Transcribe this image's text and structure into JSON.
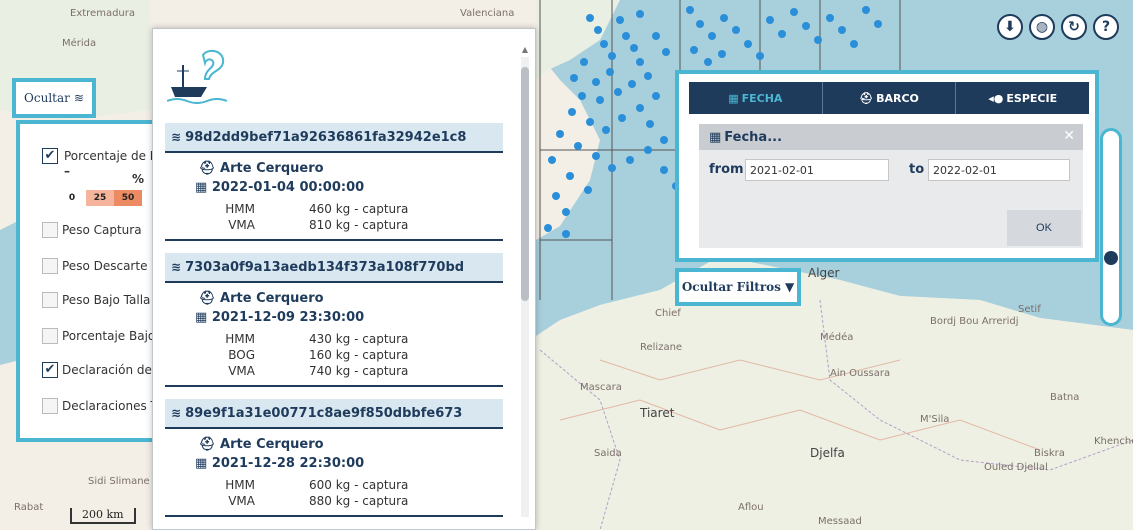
{
  "map": {
    "labels": [
      {
        "text": "Extremadura",
        "cls": "land"
      },
      {
        "text": "Mérida",
        "cls": "land"
      },
      {
        "text": "Valenciana",
        "cls": "land"
      },
      {
        "text": "Alger",
        "cls": "land"
      },
      {
        "text": "Chief",
        "cls": "land"
      },
      {
        "text": "Relizane",
        "cls": "land"
      },
      {
        "text": "Médéa",
        "cls": "land"
      },
      {
        "text": "Ain Oussara",
        "cls": "land"
      },
      {
        "text": "Tiaret",
        "cls": "land"
      },
      {
        "text": "Djelfa",
        "cls": "land"
      },
      {
        "text": "M'Sila",
        "cls": "land"
      },
      {
        "text": "Batna",
        "cls": "land"
      },
      {
        "text": "Biskra",
        "cls": "land"
      },
      {
        "text": "Bordj Bou Arreridj",
        "cls": "land"
      },
      {
        "text": "Setif",
        "cls": "land"
      },
      {
        "text": "Mascara",
        "cls": "land"
      },
      {
        "text": "Saida",
        "cls": "land"
      },
      {
        "text": "Sidi Slimane",
        "cls": "land"
      },
      {
        "text": "Rabat",
        "cls": "land"
      },
      {
        "text": "Ouled Djellal",
        "cls": "land"
      },
      {
        "text": "Aflou",
        "cls": "land"
      },
      {
        "text": "Messaad",
        "cls": "land"
      },
      {
        "text": "Khenchela",
        "cls": "land"
      }
    ],
    "scale_label": "200 km",
    "controls": [
      {
        "name": "download-icon",
        "glyph": "⬇"
      },
      {
        "name": "globe-icon",
        "glyph": "◍"
      },
      {
        "name": "refresh-icon",
        "glyph": "↻"
      },
      {
        "name": "help-icon",
        "glyph": "?"
      }
    ],
    "colors": {
      "sea": "#a7cfdc",
      "land": "#f3efe6",
      "points": "#2a8fd8",
      "grid": "#555555",
      "accent": "#4ab6d2",
      "navy": "#1f3b5c"
    }
  },
  "left": {
    "toggle_label": "Ocultar",
    "layers": [
      {
        "label": "Porcentaje de D",
        "checked": true
      },
      {
        "label": "Peso Captura",
        "checked": false
      },
      {
        "label": "Peso Descarte",
        "checked": false
      },
      {
        "label": "Peso Bajo Talla",
        "checked": false
      },
      {
        "label": "Porcentaje Bajo",
        "checked": false
      },
      {
        "label": "Declaración de",
        "checked": true
      },
      {
        "label": "Declaraciones T",
        "checked": false
      }
    ],
    "legend": {
      "dash": "–",
      "percent": "%",
      "values": [
        "0",
        "25",
        "50"
      ]
    }
  },
  "list": {
    "records": [
      {
        "id": "98d2dd9bef71a92636861fa32942e1c8",
        "gear": "Arte Cerquero",
        "datetime": "2022-01-04 00:00:00",
        "catches": [
          {
            "species": "HMM",
            "amount": "460 kg - captura"
          },
          {
            "species": "VMA",
            "amount": "810 kg - captura"
          }
        ]
      },
      {
        "id": "7303a0f9a13aedb134f373a108f770bd",
        "gear": "Arte Cerquero",
        "datetime": "2021-12-09 23:30:00",
        "catches": [
          {
            "species": "HMM",
            "amount": "430 kg - captura"
          },
          {
            "species": "BOG",
            "amount": "160 kg - captura"
          },
          {
            "species": "VMA",
            "amount": "740 kg - captura"
          }
        ]
      },
      {
        "id": "89e9f1a31e00771c8ae9f850dbbfe673",
        "gear": "Arte Cerquero",
        "datetime": "2021-12-28 22:30:00",
        "catches": [
          {
            "species": "HMM",
            "amount": "600 kg - captura"
          },
          {
            "species": "VMA",
            "amount": "880 kg - captura"
          }
        ]
      }
    ]
  },
  "filters": {
    "tabs": [
      {
        "label": "FECHA",
        "icon": "calendar-icon",
        "active": true
      },
      {
        "label": "BARCO",
        "icon": "captain-icon",
        "active": false
      },
      {
        "label": "ESPECIE",
        "icon": "fish-icon",
        "active": false
      }
    ],
    "fecha": {
      "title": "Fecha...",
      "from_label": "from",
      "from_value": "2021-02-01",
      "to_label": "to",
      "to_value": "2022-02-01",
      "ok_label": "OK"
    },
    "hide_label": "Ocultar Filtros"
  }
}
